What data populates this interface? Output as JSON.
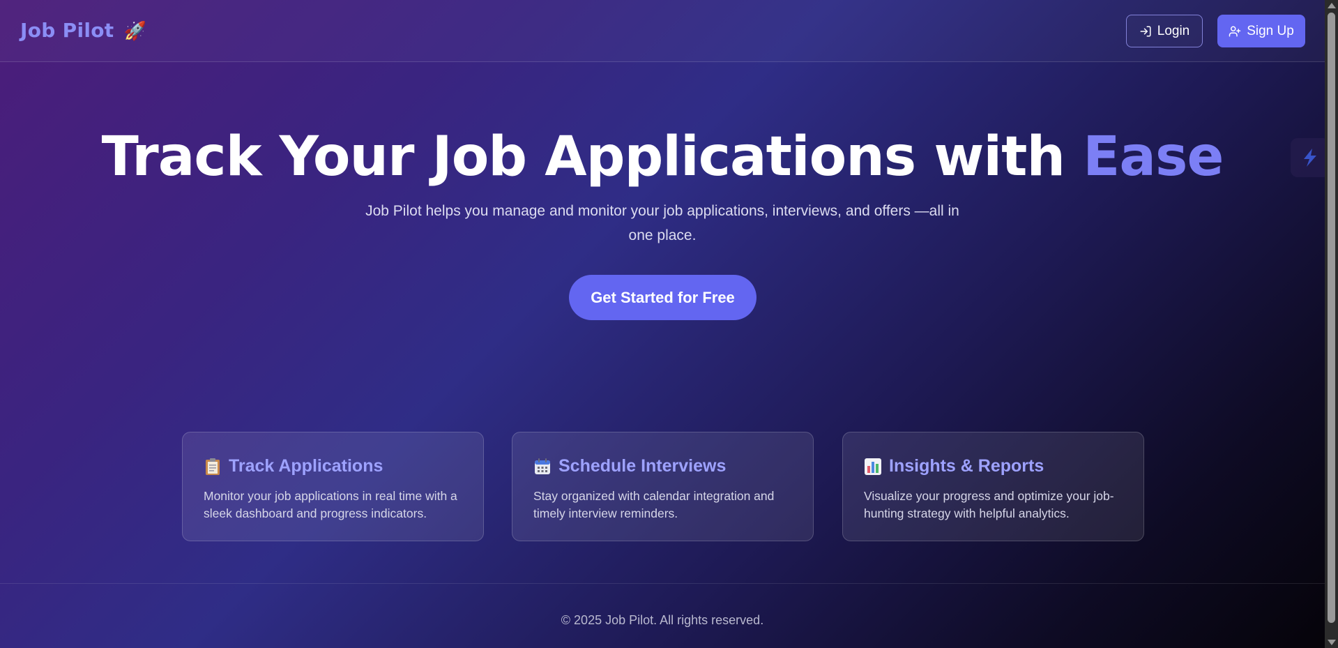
{
  "header": {
    "logo_text": "Job Pilot",
    "logo_emoji": "🚀",
    "login_label": "Login",
    "signup_label": "Sign Up"
  },
  "hero": {
    "title_main": "Track Your Job Applications with ",
    "title_accent": "Ease",
    "subtitle": "Job Pilot helps you manage and monitor your job applications, interviews, and offers —all in one place.",
    "cta_label": "Get Started for Free"
  },
  "features": [
    {
      "icon": "clipboard-icon",
      "title": "Track Applications",
      "description": "Monitor your job applications in real time with a sleek dashboard and progress indicators."
    },
    {
      "icon": "calendar-icon",
      "title": "Schedule Interviews",
      "description": "Stay organized with calendar integration and timely interview reminders."
    },
    {
      "icon": "bar-chart-icon",
      "title": "Insights & Reports",
      "description": "Visualize your progress and optimize your job-hunting strategy with helpful analytics."
    }
  ],
  "footer": {
    "copyright": "© 2025 Job Pilot. All rights reserved."
  },
  "colors": {
    "accent": "#6366f1",
    "accent_text": "#7c7ff5",
    "card_title": "#9ea2ff"
  }
}
